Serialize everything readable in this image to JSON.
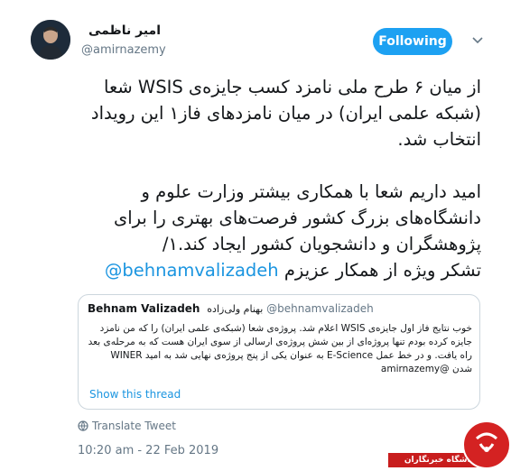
{
  "author": {
    "display_name": "امیر ناظمی",
    "handle": "@amirnazemy"
  },
  "follow_button": {
    "label": "Following"
  },
  "tweet": {
    "paragraph1": [
      "از میان ۶ طرح ملی نامزد کسب جایزه‌ی WSIS شعا",
      "(شبکه علمی ایران) در میان نامزدهای فاز۱ این رویداد",
      "انتخاب شد."
    ],
    "paragraph2": [
      "امید داریم شعا با همکاری بیشتر وزارت علوم و",
      "دانشگاه‌های بزرگ کشور فرصت‌های بهتری را برای",
      "پژوهشگران و دانشجویان کشور ایجاد کند.۱/"
    ],
    "last_line_text": "تشکر ویژه از همکار عزیزم",
    "last_line_mention": "@behnamvalizadeh"
  },
  "quote": {
    "name": "Behnam Valizadeh",
    "name_fa": "بهنام ولی‌زاده",
    "handle": "@behnamvalizadeh",
    "lines": [
      "خوب نتایج فاز اول جایزه‌ی WSIS اعلام شد. پروژه‌ی شعا (شبکه‌ی علمی ایران) را که من نامزد",
      "جایزه کرده بودم تنها پروژه‌ای از بین شش پروژه‌ی ارسالی از سوی ایران هست که به مرحله‌ی بعد",
      "راه یافت. و در خط عمل E-Science به عنوان یکی از پنج پروژه‌ی نهایی شد به امید WINER",
      "شدن @amirnazemy"
    ],
    "show_thread": "Show this thread"
  },
  "translate_label": "Translate Tweet",
  "timestamp": "10:20 am - 22 Feb 2019",
  "watermark": {
    "text": "باشگاه خبرنگاران"
  },
  "colors": {
    "follow_bg": "#1da1f2",
    "link": "#1b95e0",
    "muted": "#657786",
    "watermark_red": "#c81d1d"
  },
  "icons": {
    "caret": "chevron-down-icon",
    "translate": "globe-icon",
    "watermark_logo": "yjc-logo"
  }
}
